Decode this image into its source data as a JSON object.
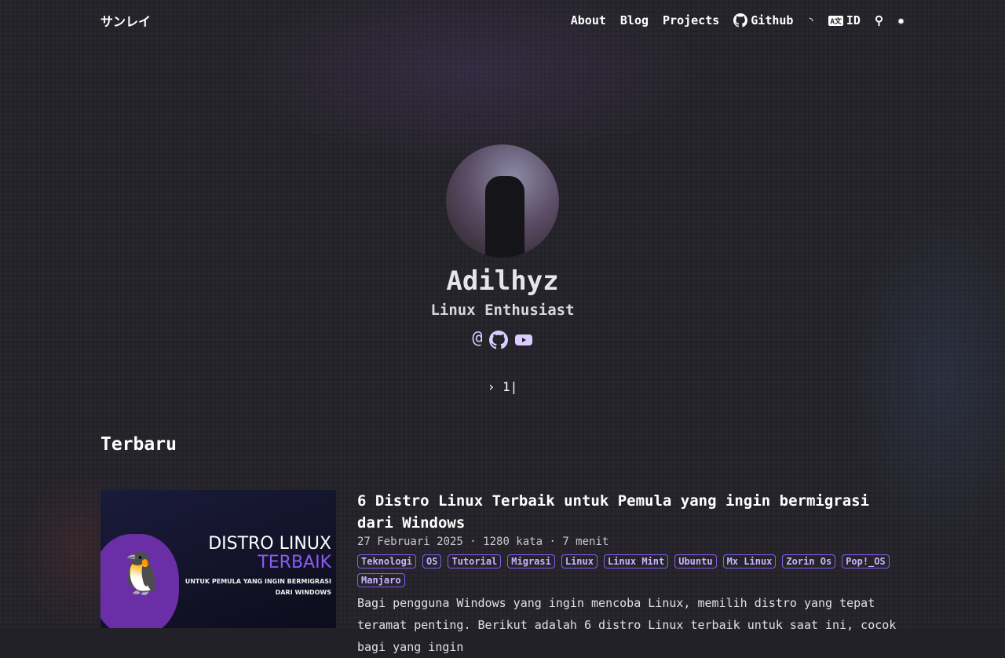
{
  "header": {
    "logo": "サンレイ",
    "nav": [
      {
        "label": "About"
      },
      {
        "label": "Blog"
      },
      {
        "label": "Projects"
      },
      {
        "label": "Github",
        "icon": "github-icon"
      }
    ],
    "rss_icon": "rss-icon",
    "lang": "ID",
    "search_icon": "search-icon",
    "theme_icon": "sun-icon"
  },
  "profile": {
    "name": "Adilhyz",
    "tagline": "Linux Enthusiast",
    "socials": [
      "email-icon",
      "github-icon",
      "youtube-icon"
    ],
    "typed": "1"
  },
  "section": {
    "title": "Terbaru"
  },
  "posts": [
    {
      "thumbnail": {
        "line1": "DISTRO LINUX",
        "line2": "TERBAIK",
        "line3": "UNTUK PEMULA YANG INGIN BERMIGRASI DARI WINDOWS"
      },
      "title": "6 Distro Linux Terbaik untuk Pemula yang ingin bermigrasi dari Windows",
      "date": "27 Februari 2025",
      "words": "1280 kata",
      "read": "7 menit",
      "tags": [
        "Teknologi",
        "OS",
        "Tutorial",
        "Migrasi",
        "Linux",
        "Linux Mint",
        "Ubuntu",
        "Mx Linux",
        "Zorin Os",
        "Pop!_OS",
        "Manjaro"
      ],
      "summary": "Bagi pengguna Windows yang ingin mencoba Linux, memilih distro yang tepat teramat penting. Berikut adalah 6 distro Linux terbaik untuk saat ini, cocok bagi yang ingin"
    }
  ],
  "colors": {
    "background": "#222127",
    "accent": "#8b5cf6"
  }
}
